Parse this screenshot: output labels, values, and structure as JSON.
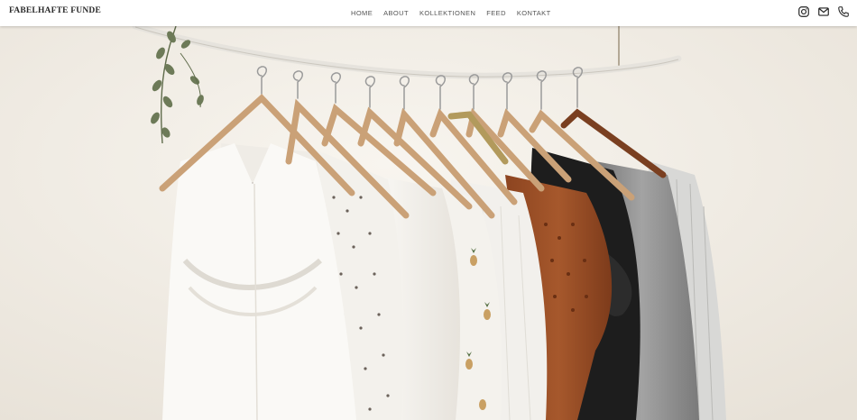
{
  "site": {
    "brand": "FABELHAFTE FUNDE"
  },
  "nav": {
    "items": [
      "HOME",
      "ABOUT",
      "KOLLEKTIONEN",
      "FEED",
      "KONTAKT"
    ]
  },
  "social": {
    "icons": [
      "instagram-icon",
      "mail-icon",
      "phone-icon"
    ]
  },
  "hero": {
    "image": "clothes-on-hangers-rail",
    "palette": {
      "wall": "#f1ede6",
      "wood": "#c99a6c",
      "rust": "#9c4f26",
      "black": "#1d1d1d",
      "grey": "#8a8a8a",
      "white": "#f7f5f1"
    }
  }
}
